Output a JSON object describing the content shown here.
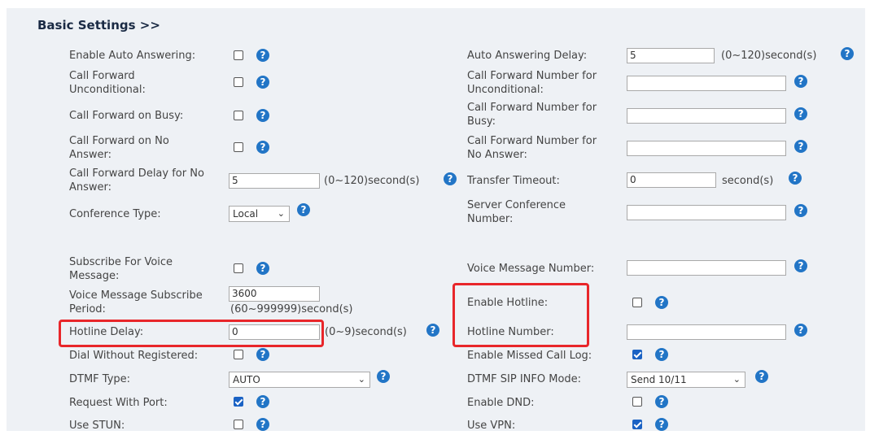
{
  "section_title": "Basic Settings >>",
  "left": {
    "auto_answer_label": "Enable Auto Answering:",
    "cfu_label_1": "Call Forward",
    "cfu_label_2": "Unconditional:",
    "cfb_label": "Call Forward on Busy:",
    "cfna_label_1": "Call Forward on No",
    "cfna_label_2": "Answer:",
    "cfdelay_label_1": "Call Forward Delay for No",
    "cfdelay_label_2": "Answer:",
    "cfdelay_value": "5",
    "cfdelay_unit": "(0~120)second(s)",
    "conf_type_label": "Conference Type:",
    "conf_type_value": "Local",
    "subscribe_vm_label_1": "Subscribe For Voice",
    "subscribe_vm_label_2": "Message:",
    "vm_period_label_1": "Voice Message Subscribe",
    "vm_period_label_2": "Period:",
    "vm_period_value": "3600",
    "vm_period_unit": "(60~999999)second(s)",
    "hotline_delay_label": "Hotline Delay:",
    "hotline_delay_value": "0",
    "hotline_delay_unit": "(0~9)second(s)",
    "dial_unreg_label": "Dial Without Registered:",
    "dtmf_type_label": "DTMF Type:",
    "dtmf_type_value": "AUTO",
    "request_port_label": "Request With Port:",
    "stun_label": "Use STUN:"
  },
  "right": {
    "auto_answer_delay_label": "Auto Answering Delay:",
    "auto_answer_delay_value": "5",
    "auto_answer_delay_unit": "(0~120)second(s)",
    "cfu_num_label_1": "Call Forward Number for",
    "cfu_num_label_2": "Unconditional:",
    "cfb_num_label_1": "Call Forward Number for",
    "cfb_num_label_2": "Busy:",
    "cfna_num_label_1": "Call Forward Number for",
    "cfna_num_label_2": "No Answer:",
    "transfer_timeout_label": "Transfer Timeout:",
    "transfer_timeout_value": "0",
    "transfer_timeout_unit": "second(s)",
    "server_conf_label_1": "Server Conference",
    "server_conf_label_2": "Number:",
    "vm_number_label": "Voice Message Number:",
    "enable_hotline_label": "Enable Hotline:",
    "hotline_number_label": "Hotline Number:",
    "missed_call_label": "Enable Missed Call Log:",
    "dtmf_sip_label": "DTMF SIP INFO Mode:",
    "dtmf_sip_value": "Send 10/11",
    "dnd_label": "Enable DND:",
    "vpn_label": "Use VPN:"
  },
  "checkboxes": {
    "auto_answer": false,
    "cfu": false,
    "cfb": false,
    "cfna": false,
    "subscribe_vm": false,
    "dial_unreg": false,
    "request_port": true,
    "stun": false,
    "hotline": false,
    "missed_call": true,
    "dnd": false,
    "vpn": true
  },
  "icons": {
    "help": "?",
    "chevron": "⌄"
  },
  "colors": {
    "highlight": "#e8262a",
    "accent": "#2275c6",
    "checked": "#1a62c4"
  }
}
